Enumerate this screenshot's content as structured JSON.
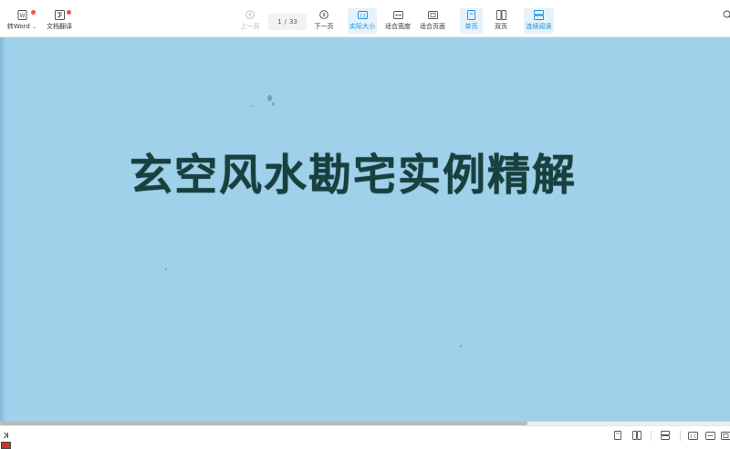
{
  "toolbar": {
    "to_word": "转Word",
    "translate": "文档翻译",
    "prev_page": "上一页",
    "current_page": "1",
    "page_sep": "/",
    "total_pages": "33",
    "next_page": "下一页",
    "actual_size": "实际大小",
    "fit_width": "适合宽度",
    "fit_page": "适合页面",
    "single_page": "单页",
    "double_page": "双页",
    "continuous": "连续阅读"
  },
  "document": {
    "title": "玄空风水勘宅实例精解"
  },
  "colors": {
    "accent": "#1e8fd6",
    "active_bg": "#e4f2fb",
    "page_bg": "#9fd1eb",
    "title_ink": "#18403f",
    "badge": "#ff4d4f"
  },
  "icons": {
    "to_word": "word-icon",
    "translate": "translate-icon",
    "prev": "circle-arrow-left-icon",
    "next": "circle-arrow-right-icon",
    "actual_size": "actual-size-icon",
    "fit_width": "fit-width-icon",
    "fit_page": "fit-page-icon",
    "single": "single-page-icon",
    "double": "double-page-icon",
    "continuous": "continuous-icon"
  }
}
